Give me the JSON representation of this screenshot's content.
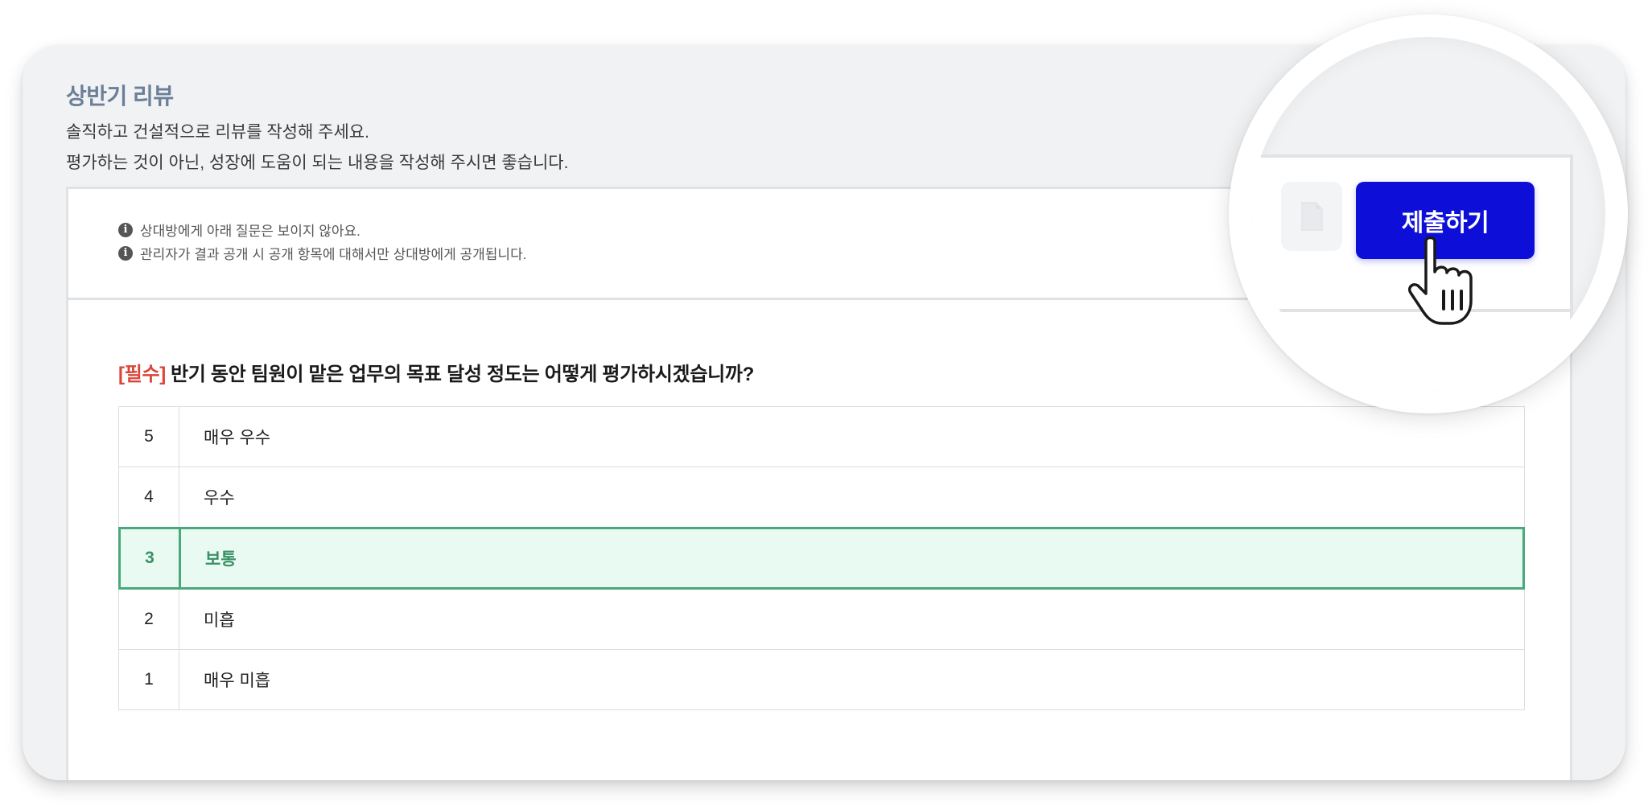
{
  "review": {
    "title": "상반기 리뷰",
    "description_line1": "솔직하고 건설적으로 리뷰를 작성해 주세요.",
    "description_line2": "평가하는 것이 아닌, 성장에 도움이 되는 내용을 작성해 주시면 좋습니다."
  },
  "notices": [
    {
      "icon": "info-icon",
      "icon_glyph": "i",
      "text": "상대방에게 아래 질문은 보이지 않아요."
    },
    {
      "icon": "info-icon",
      "icon_glyph": "i",
      "text": "관리자가 결과 공개 시 공개 항목에 대해서만 상대방에게 공개됩니다."
    }
  ],
  "question": {
    "required_tag": "[필수]",
    "text": "반기 동안 팀원이 맡은 업무의 목표 달성 정도는 어떻게 평가하시겠습니까?",
    "options": [
      {
        "score": "5",
        "label": "매우 우수"
      },
      {
        "score": "4",
        "label": "우수"
      },
      {
        "score": "3",
        "label": "보통"
      },
      {
        "score": "2",
        "label": "미흡"
      },
      {
        "score": "1",
        "label": "매우 미흡"
      }
    ],
    "selected_score": "3"
  },
  "actions": {
    "submit_label": "제출하기",
    "draft_icon": "document-icon"
  },
  "colors": {
    "submit_bg": "#0d0fd9",
    "selected_border": "#4aa97a",
    "selected_bg": "#e8faf2",
    "required": "#d9463a",
    "title": "#6c7f99"
  }
}
